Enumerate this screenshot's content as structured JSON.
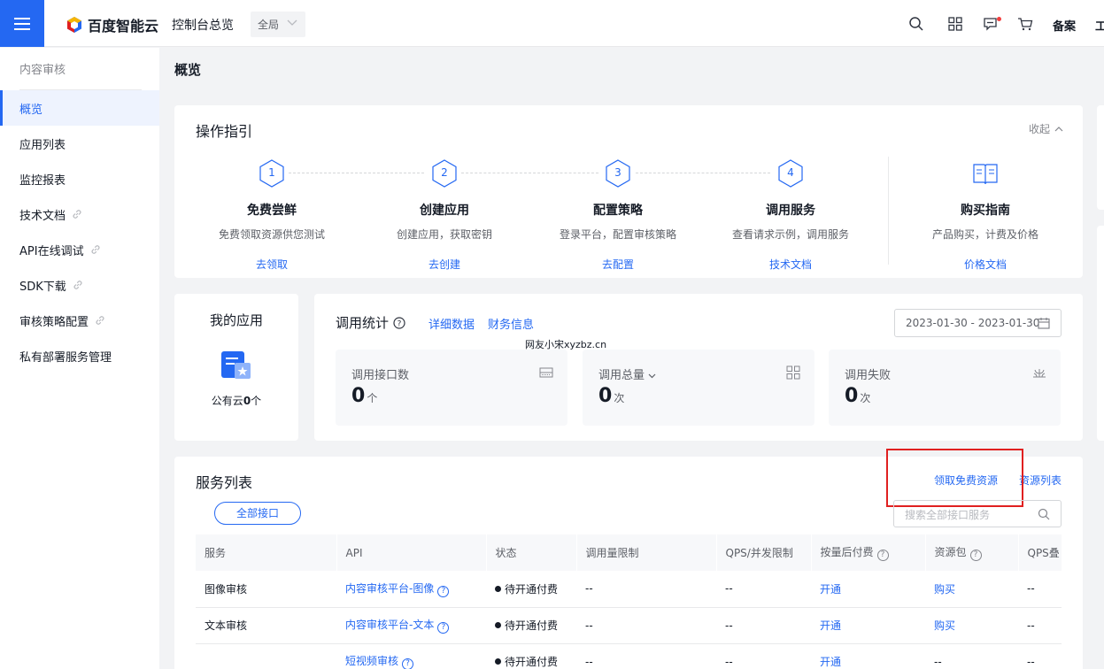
{
  "topbar": {
    "brand": "百度智能云",
    "console_title": "控制台总览",
    "region": "全局",
    "filing": "备案",
    "work_order": "工"
  },
  "sidebar": {
    "product": "内容审核",
    "items": [
      {
        "label": "概览",
        "active": true
      },
      {
        "label": "应用列表"
      },
      {
        "label": "监控报表"
      },
      {
        "label": "技术文档",
        "external": true
      },
      {
        "label": "API在线调试",
        "external": true
      },
      {
        "label": "SDK下载",
        "external": true
      },
      {
        "label": "审核策略配置",
        "external": true
      },
      {
        "label": "私有部署服务管理"
      }
    ]
  },
  "page": {
    "title": "概览"
  },
  "guide": {
    "title": "操作指引",
    "collapse": "收起",
    "steps": [
      {
        "num": "1",
        "name": "免费尝鲜",
        "desc": "免费领取资源供您测试",
        "link": "去领取"
      },
      {
        "num": "2",
        "name": "创建应用",
        "desc": "创建应用，获取密钥",
        "link": "去创建"
      },
      {
        "num": "3",
        "name": "配置策略",
        "desc": "登录平台，配置审核策略",
        "link": "去配置"
      },
      {
        "num": "4",
        "name": "调用服务",
        "desc": "查看请求示例，调用服务",
        "link": "技术文档"
      }
    ],
    "purchase": {
      "name": "购买指南",
      "desc": "产品购买，计费及价格",
      "link": "价格文档"
    }
  },
  "my_apps": {
    "title": "我的应用",
    "public_prefix": "公有云",
    "count": "0",
    "unit": "个"
  },
  "stats": {
    "title": "调用统计",
    "detail_link": "详细数据",
    "finance_link": "财务信息",
    "date_range": "2023-01-30 - 2023-01-30",
    "watermark": "网友小宋xyzbz.cn",
    "boxes": [
      {
        "label": "调用接口数",
        "value": "0",
        "unit": "个"
      },
      {
        "label": "调用总量",
        "value": "0",
        "unit": "次"
      },
      {
        "label": "调用失败",
        "value": "0",
        "unit": "次"
      }
    ]
  },
  "services": {
    "title": "服务列表",
    "free_resource_link": "领取免费资源",
    "resource_list_link": "资源列表",
    "filter_all": "全部接口",
    "search_placeholder": "搜索全部接口服务",
    "columns": [
      "服务",
      "API",
      "状态",
      "调用量限制",
      "QPS/并发限制",
      "按量后付费",
      "资源包",
      "QPS叠"
    ],
    "rows": [
      {
        "service": "图像审核",
        "api": "内容审核平台-图像",
        "status": "待开通付费",
        "limit": "--",
        "qps": "--",
        "postpaid": "开通",
        "package": "购买",
        "qps_stack": "--"
      },
      {
        "service": "文本审核",
        "api": "内容审核平台-文本",
        "status": "待开通付费",
        "limit": "--",
        "qps": "--",
        "postpaid": "开通",
        "package": "购买",
        "qps_stack": "--"
      },
      {
        "service": "",
        "api": "短视频审核",
        "status": "待开通付费",
        "limit": "--",
        "qps": "--",
        "postpaid": "开通",
        "package": "--",
        "qps_stack": "--"
      }
    ]
  },
  "colors": {
    "accent": "#2468f2",
    "highlight_box": "#e02020"
  }
}
